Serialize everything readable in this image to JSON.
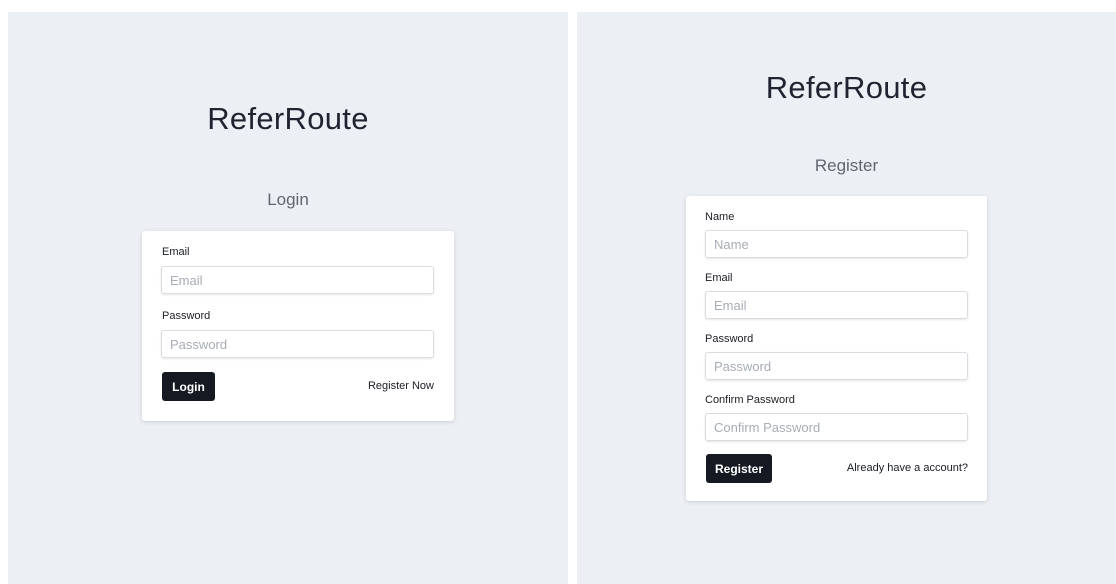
{
  "login": {
    "brand": "ReferRoute",
    "title": "Login",
    "email_label": "Email",
    "email_placeholder": "Email",
    "password_label": "Password",
    "password_placeholder": "Password",
    "submit_label": "Login",
    "register_link": "Register Now"
  },
  "register": {
    "brand": "ReferRoute",
    "title": "Register",
    "name_label": "Name",
    "name_placeholder": "Name",
    "email_label": "Email",
    "email_placeholder": "Email",
    "password_label": "Password",
    "password_placeholder": "Password",
    "confirm_label": "Confirm Password",
    "confirm_placeholder": "Confirm Password",
    "submit_label": "Register",
    "login_link": "Already have a account?"
  },
  "colors": {
    "background": "#ecf0f4",
    "card": "#ffffff",
    "button": "#151a22",
    "text": "#1a1d24"
  }
}
